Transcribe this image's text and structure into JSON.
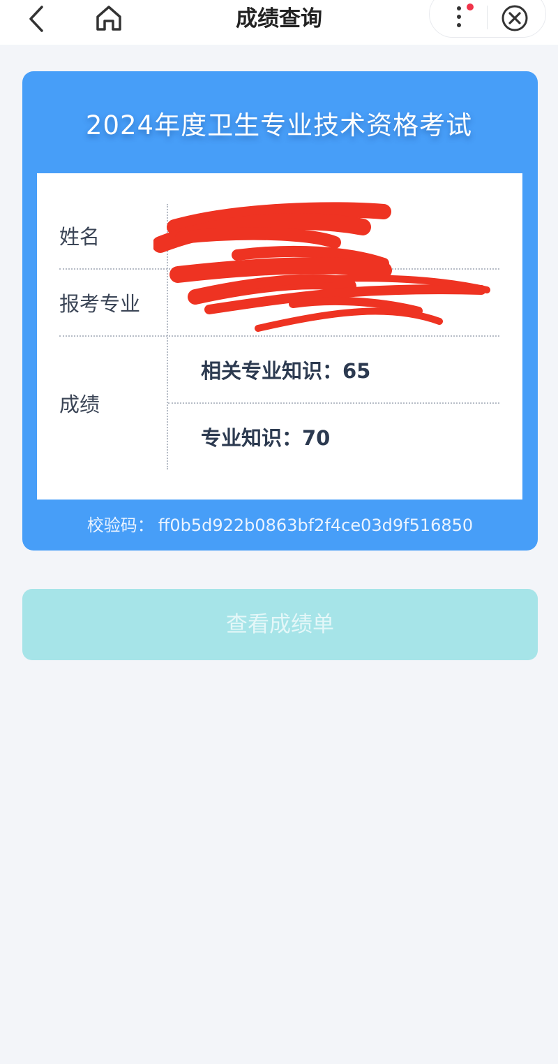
{
  "nav": {
    "title": "成绩查询"
  },
  "card": {
    "title": "2024年度卫生专业技术资格考试",
    "rows": {
      "name_label": "姓名",
      "major_label": "报考专业",
      "score_label": "成绩"
    },
    "scores": [
      {
        "text": "相关专业知识：65"
      },
      {
        "text": "专业知识：70"
      }
    ],
    "verify_label": "校验码：",
    "verify_code": "ff0b5d922b0863bf2f4ce03d9f516850"
  },
  "actions": {
    "view_report_label": "查看成绩单"
  },
  "colors": {
    "card_blue": "#479ef8",
    "button_cyan": "#a6e4e8",
    "redaction_red": "#ee3322",
    "notification_dot": "#f0344a"
  },
  "icons": [
    "back-arrow-icon",
    "home-icon",
    "more-dots-icon",
    "close-circle-icon"
  ]
}
